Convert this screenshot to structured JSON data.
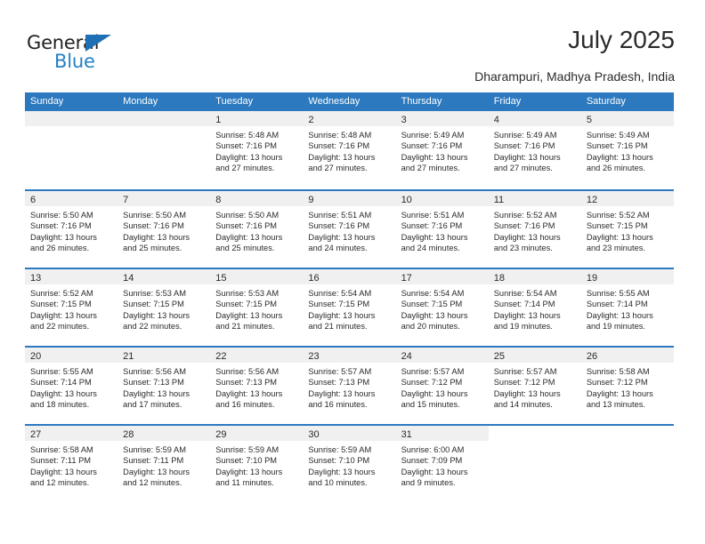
{
  "logo": {
    "primary_text": "General",
    "secondary_text": "Blue",
    "primary_color": "#231f20",
    "secondary_color": "#2580c3",
    "triangle_color": "#1f6fb4"
  },
  "header": {
    "title": "July 2025",
    "subtitle": "Dharampuri, Madhya Pradesh, India"
  },
  "theme": {
    "header_blue": "#2c79bf",
    "day_band_gray": "#f0f0f0",
    "text": "#2b2b2b"
  },
  "weekdays": [
    "Sunday",
    "Monday",
    "Tuesday",
    "Wednesday",
    "Thursday",
    "Friday",
    "Saturday"
  ],
  "weeks": [
    [
      {
        "day": "",
        "lines": []
      },
      {
        "day": "",
        "lines": []
      },
      {
        "day": "1",
        "lines": [
          "Sunrise: 5:48 AM",
          "Sunset: 7:16 PM",
          "Daylight: 13 hours",
          "and 27 minutes."
        ]
      },
      {
        "day": "2",
        "lines": [
          "Sunrise: 5:48 AM",
          "Sunset: 7:16 PM",
          "Daylight: 13 hours",
          "and 27 minutes."
        ]
      },
      {
        "day": "3",
        "lines": [
          "Sunrise: 5:49 AM",
          "Sunset: 7:16 PM",
          "Daylight: 13 hours",
          "and 27 minutes."
        ]
      },
      {
        "day": "4",
        "lines": [
          "Sunrise: 5:49 AM",
          "Sunset: 7:16 PM",
          "Daylight: 13 hours",
          "and 27 minutes."
        ]
      },
      {
        "day": "5",
        "lines": [
          "Sunrise: 5:49 AM",
          "Sunset: 7:16 PM",
          "Daylight: 13 hours",
          "and 26 minutes."
        ]
      }
    ],
    [
      {
        "day": "6",
        "lines": [
          "Sunrise: 5:50 AM",
          "Sunset: 7:16 PM",
          "Daylight: 13 hours",
          "and 26 minutes."
        ]
      },
      {
        "day": "7",
        "lines": [
          "Sunrise: 5:50 AM",
          "Sunset: 7:16 PM",
          "Daylight: 13 hours",
          "and 25 minutes."
        ]
      },
      {
        "day": "8",
        "lines": [
          "Sunrise: 5:50 AM",
          "Sunset: 7:16 PM",
          "Daylight: 13 hours",
          "and 25 minutes."
        ]
      },
      {
        "day": "9",
        "lines": [
          "Sunrise: 5:51 AM",
          "Sunset: 7:16 PM",
          "Daylight: 13 hours",
          "and 24 minutes."
        ]
      },
      {
        "day": "10",
        "lines": [
          "Sunrise: 5:51 AM",
          "Sunset: 7:16 PM",
          "Daylight: 13 hours",
          "and 24 minutes."
        ]
      },
      {
        "day": "11",
        "lines": [
          "Sunrise: 5:52 AM",
          "Sunset: 7:16 PM",
          "Daylight: 13 hours",
          "and 23 minutes."
        ]
      },
      {
        "day": "12",
        "lines": [
          "Sunrise: 5:52 AM",
          "Sunset: 7:15 PM",
          "Daylight: 13 hours",
          "and 23 minutes."
        ]
      }
    ],
    [
      {
        "day": "13",
        "lines": [
          "Sunrise: 5:52 AM",
          "Sunset: 7:15 PM",
          "Daylight: 13 hours",
          "and 22 minutes."
        ]
      },
      {
        "day": "14",
        "lines": [
          "Sunrise: 5:53 AM",
          "Sunset: 7:15 PM",
          "Daylight: 13 hours",
          "and 22 minutes."
        ]
      },
      {
        "day": "15",
        "lines": [
          "Sunrise: 5:53 AM",
          "Sunset: 7:15 PM",
          "Daylight: 13 hours",
          "and 21 minutes."
        ]
      },
      {
        "day": "16",
        "lines": [
          "Sunrise: 5:54 AM",
          "Sunset: 7:15 PM",
          "Daylight: 13 hours",
          "and 21 minutes."
        ]
      },
      {
        "day": "17",
        "lines": [
          "Sunrise: 5:54 AM",
          "Sunset: 7:15 PM",
          "Daylight: 13 hours",
          "and 20 minutes."
        ]
      },
      {
        "day": "18",
        "lines": [
          "Sunrise: 5:54 AM",
          "Sunset: 7:14 PM",
          "Daylight: 13 hours",
          "and 19 minutes."
        ]
      },
      {
        "day": "19",
        "lines": [
          "Sunrise: 5:55 AM",
          "Sunset: 7:14 PM",
          "Daylight: 13 hours",
          "and 19 minutes."
        ]
      }
    ],
    [
      {
        "day": "20",
        "lines": [
          "Sunrise: 5:55 AM",
          "Sunset: 7:14 PM",
          "Daylight: 13 hours",
          "and 18 minutes."
        ]
      },
      {
        "day": "21",
        "lines": [
          "Sunrise: 5:56 AM",
          "Sunset: 7:13 PM",
          "Daylight: 13 hours",
          "and 17 minutes."
        ]
      },
      {
        "day": "22",
        "lines": [
          "Sunrise: 5:56 AM",
          "Sunset: 7:13 PM",
          "Daylight: 13 hours",
          "and 16 minutes."
        ]
      },
      {
        "day": "23",
        "lines": [
          "Sunrise: 5:57 AM",
          "Sunset: 7:13 PM",
          "Daylight: 13 hours",
          "and 16 minutes."
        ]
      },
      {
        "day": "24",
        "lines": [
          "Sunrise: 5:57 AM",
          "Sunset: 7:12 PM",
          "Daylight: 13 hours",
          "and 15 minutes."
        ]
      },
      {
        "day": "25",
        "lines": [
          "Sunrise: 5:57 AM",
          "Sunset: 7:12 PM",
          "Daylight: 13 hours",
          "and 14 minutes."
        ]
      },
      {
        "day": "26",
        "lines": [
          "Sunrise: 5:58 AM",
          "Sunset: 7:12 PM",
          "Daylight: 13 hours",
          "and 13 minutes."
        ]
      }
    ],
    [
      {
        "day": "27",
        "lines": [
          "Sunrise: 5:58 AM",
          "Sunset: 7:11 PM",
          "Daylight: 13 hours",
          "and 12 minutes."
        ]
      },
      {
        "day": "28",
        "lines": [
          "Sunrise: 5:59 AM",
          "Sunset: 7:11 PM",
          "Daylight: 13 hours",
          "and 12 minutes."
        ]
      },
      {
        "day": "29",
        "lines": [
          "Sunrise: 5:59 AM",
          "Sunset: 7:10 PM",
          "Daylight: 13 hours",
          "and 11 minutes."
        ]
      },
      {
        "day": "30",
        "lines": [
          "Sunrise: 5:59 AM",
          "Sunset: 7:10 PM",
          "Daylight: 13 hours",
          "and 10 minutes."
        ]
      },
      {
        "day": "31",
        "lines": [
          "Sunrise: 6:00 AM",
          "Sunset: 7:09 PM",
          "Daylight: 13 hours",
          "and 9 minutes."
        ]
      },
      {
        "day": "",
        "lines": []
      },
      {
        "day": "",
        "lines": []
      }
    ]
  ]
}
